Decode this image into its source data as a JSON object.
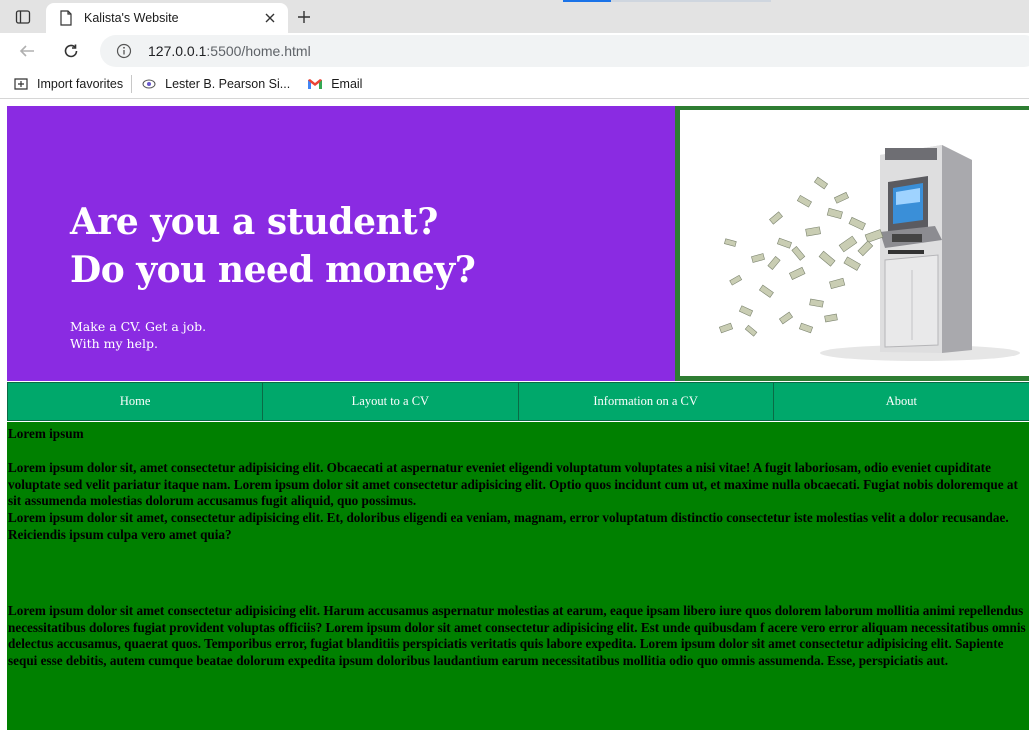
{
  "browser": {
    "tab_title": "Kalista's Website",
    "url_host": "127.0.0.1",
    "url_rest": ":5500/home.html",
    "favorites": [
      {
        "label": "Import favorites",
        "icon": "import-icon"
      },
      {
        "label": "Lester B. Pearson Si...",
        "icon": "school-icon"
      },
      {
        "label": "Email",
        "icon": "gmail-icon"
      }
    ]
  },
  "hero": {
    "title_line1": "Are you a student?",
    "title_line2": "Do you need money?",
    "sub_line1": "Make a CV. Get a job.",
    "sub_line2": "With my help.",
    "image": "atm-money-image",
    "bg_color": "#8a2be2"
  },
  "nav": {
    "items": [
      {
        "label": "Home"
      },
      {
        "label": "Layout to a CV"
      },
      {
        "label": "Information on a CV"
      },
      {
        "label": "About"
      }
    ],
    "bg_color": "#00a86b"
  },
  "content": {
    "heading": "Lorem ipsum",
    "p1": "Lorem ipsum dolor sit, amet consectetur adipisicing elit. Obcaecati at aspernatur eveniet eligendi voluptatum voluptates a nisi vitae! A fugit laboriosam, odio eveniet cupiditate voluptate sed velit pariatur itaque nam. Lorem ipsum dolor sit amet consectetur adipisicing elit. Optio quos incidunt cum ut, et maxime nulla obcaecati. Fugiat nobis doloremque at sit assumenda molestias dolorum accusamus fugit aliquid, quo possimus.",
    "p2": "Lorem ipsum dolor sit amet, consectetur adipisicing elit. Et, doloribus eligendi ea veniam, magnam, error voluptatum distinctio consectetur iste molestias velit a dolor recusandae. Reiciendis ipsum culpa vero amet quia?",
    "p3": "Lorem ipsum dolor sit amet consectetur adipisicing elit. Harum accusamus aspernatur molestias at earum, eaque ipsam libero iure quos dolorem laborum mollitia animi repellendus necessitatibus dolores fugiat provident voluptas officiis? Lorem ipsum dolor sit amet consectetur adipisicing elit. Est unde quibusdam f acere vero error aliquam necessitatibus omnis delectus accusamus, quaerat quos. Temporibus error, fugiat blanditiis perspiciatis veritatis quis labore expedita. Lorem ipsum dolor sit amet consectetur adipisicing elit. Sapiente sequi esse debitis, autem cumque beatae dolorum expedita ipsum doloribus laudantium earum necessitatibus mollitia odio quo omnis assumenda. Esse, perspiciatis aut.",
    "bg_color": "#008000"
  }
}
